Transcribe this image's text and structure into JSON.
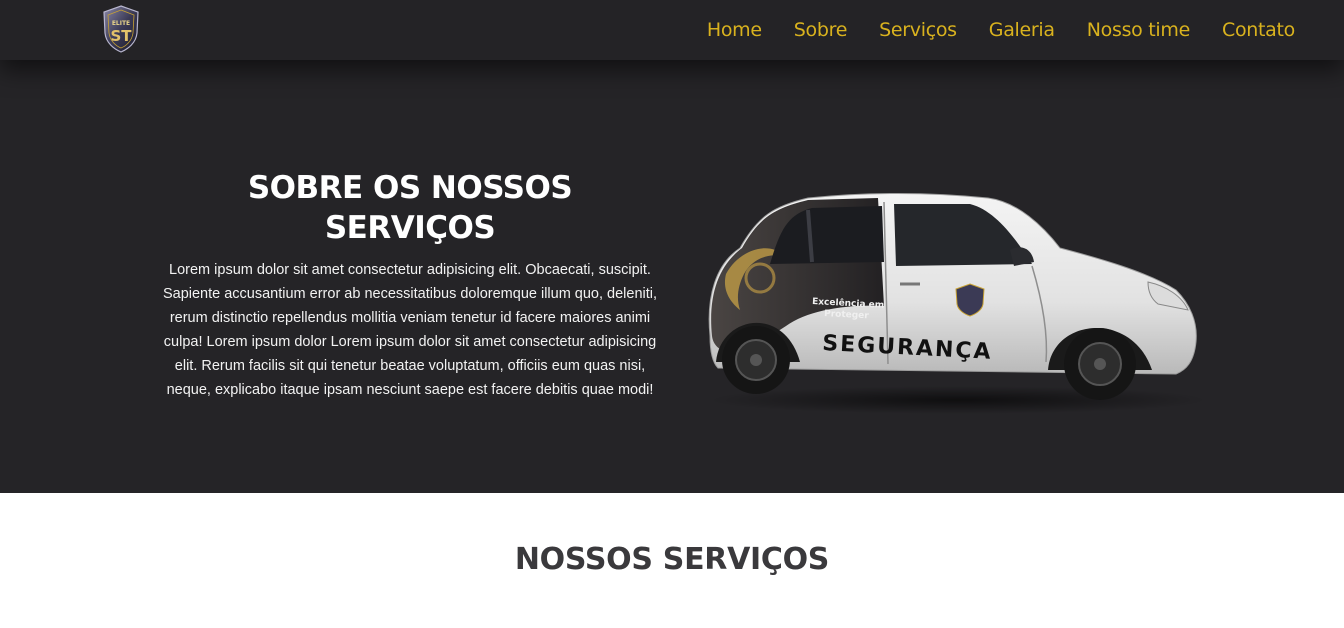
{
  "nav": {
    "logo_text_top": "ELITE",
    "logo_text_main": "ST",
    "links": [
      "Home",
      "Sobre",
      "Serviços",
      "Galeria",
      "Nosso time",
      "Contato"
    ],
    "link_color": "#d9b21e",
    "background_color": "#242326"
  },
  "about": {
    "title": "SOBRE OS NOSSOS SERVIÇOS",
    "body": "Lorem ipsum dolor sit amet consectetur adipisicing elit. Obcaecati, suscipit. Sapiente accusantium error ab necessitatibus doloremque illum quo, deleniti, rerum distinctio repellendus mollitia veniam tenetur id facere maiores animi culpa! Lorem ipsum dolor Lorem ipsum dolor sit amet consectetur adipisicing elit. Rerum facilis sit qui tenetur beatae voluptatum, officiis eum quas nisi, neque, explicabo itaque ipsam nesciunt saepe est facere debitis quae modi!",
    "car_door_text": "SEGURANÇA",
    "car_slogan_line1": "Excelência em",
    "car_slogan_line2": "Proteger",
    "background_color": "#252427"
  },
  "services": {
    "title": "NOSSOS SERVIÇOS"
  }
}
